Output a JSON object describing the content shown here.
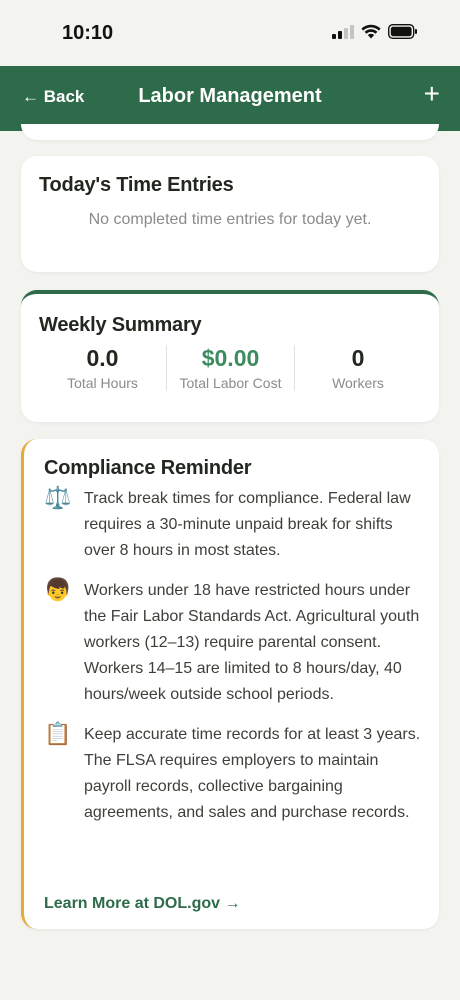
{
  "status_bar": {
    "time": "10:10"
  },
  "header": {
    "back_label": "← Back",
    "title": "Labor Management",
    "add_label": "+"
  },
  "time_entries": {
    "title": "Today's Time Entries",
    "empty_text": "No completed time entries for today yet."
  },
  "weekly_summary": {
    "title": "Weekly Summary",
    "stats": [
      {
        "value": "0.0",
        "label": "Total Hours"
      },
      {
        "value": "$0.00",
        "label": "Total Labor Cost"
      },
      {
        "value": "0",
        "label": "Workers"
      }
    ]
  },
  "compliance": {
    "title": "Compliance Reminder",
    "items": [
      {
        "icon": "scales-icon",
        "glyph": "⚖️",
        "text": "Track break times for compliance. Federal law requires a 30-minute unpaid break for shifts over 8 hours in most states."
      },
      {
        "icon": "child-icon",
        "glyph": "👦",
        "text": "Workers under 18 have restricted hours under the Fair Labor Standards Act. Agricultural youth workers (12–13) require parental consent. Workers 14–15 are limited to 8 hours/day, 40 hours/week outside school periods."
      },
      {
        "icon": "clipboard-icon",
        "glyph": "📋",
        "text": "Keep accurate time records for at least 3 years. The FLSA requires employers to maintain payroll records, collective bargaining agreements, and sales and purchase records."
      }
    ],
    "link_label": "Learn More at DOL.gov →"
  },
  "colors": {
    "header_bg": "#2e6b4a",
    "accent_green": "#3d8c5f",
    "compliance_border": "#e8a83a",
    "page_bg": "#f3f3ef"
  }
}
